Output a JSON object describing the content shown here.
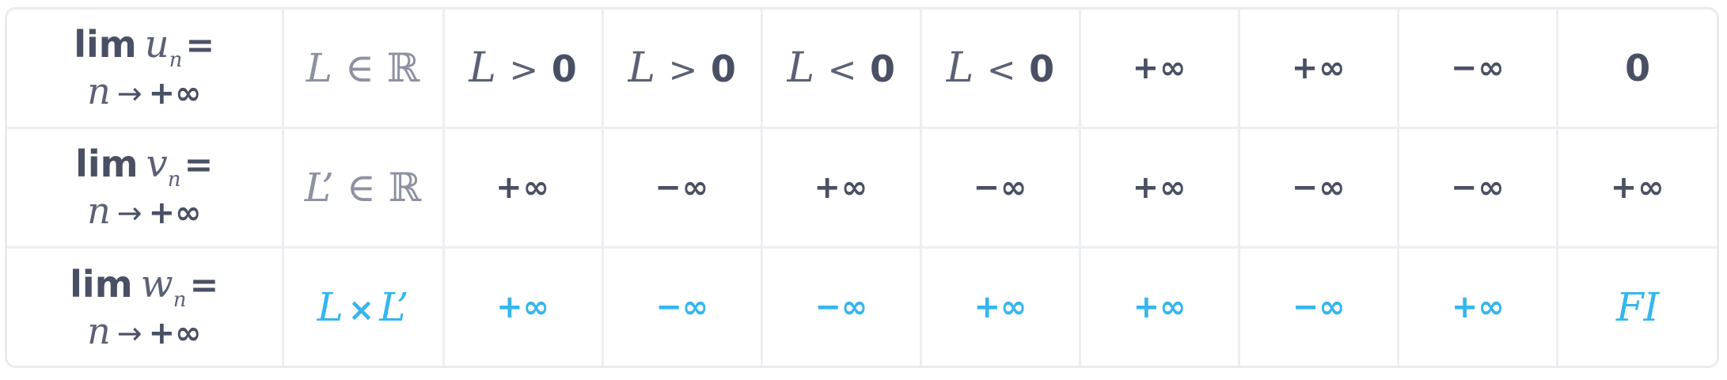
{
  "colors": {
    "text": "#4a5064",
    "muted": "#8d92a1",
    "accent": "#35b6ee",
    "grid": "#eceef1"
  },
  "rows": [
    {
      "header": {
        "lim": "lim",
        "var": "u",
        "sub": "n",
        "eq": "=",
        "n": "n",
        "arrow": "→",
        "inf": "+∞"
      },
      "cells": {
        "c0": {
          "a": "L",
          "op": "∈",
          "b": "ℝ"
        },
        "c1": {
          "a": "L",
          "op": ">",
          "b": "0"
        },
        "c2": {
          "a": "L",
          "op": ">",
          "b": "0"
        },
        "c3": {
          "a": "L",
          "op": "<",
          "b": "0"
        },
        "c4": {
          "a": "L",
          "op": "<",
          "b": "0"
        },
        "c5": "+∞",
        "c6": "+∞",
        "c7": "−∞",
        "c8": "0"
      }
    },
    {
      "header": {
        "lim": "lim",
        "var": "v",
        "sub": "n",
        "eq": "=",
        "n": "n",
        "arrow": "→",
        "inf": "+∞"
      },
      "cells": {
        "c0": {
          "a": "L’",
          "op": "∈",
          "b": "ℝ"
        },
        "c1": "+∞",
        "c2": "−∞",
        "c3": "+∞",
        "c4": "−∞",
        "c5": "+∞",
        "c6": "−∞",
        "c7": "−∞",
        "c8": "+∞"
      }
    },
    {
      "header": {
        "lim": "lim",
        "var": "w",
        "sub": "n",
        "eq": "=",
        "n": "n",
        "arrow": "→",
        "inf": "+∞"
      },
      "cells": {
        "c0": {
          "a": "L",
          "op": "×",
          "b": "L’"
        },
        "c1": "+∞",
        "c2": "−∞",
        "c3": "−∞",
        "c4": "+∞",
        "c5": "+∞",
        "c6": "−∞",
        "c7": "+∞",
        "c8": "FI"
      }
    }
  ]
}
